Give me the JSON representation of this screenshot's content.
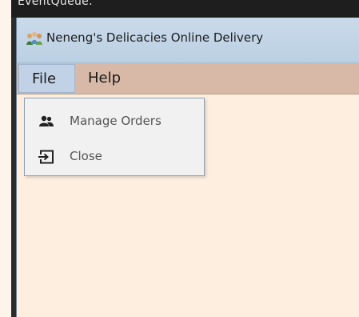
{
  "background": {
    "code_text": "EventQueue."
  },
  "window": {
    "title": "Neneng's Delicacies Online Delivery",
    "app_icon": "people-icon"
  },
  "menubar": {
    "items": [
      {
        "label": "File"
      },
      {
        "label": "Help"
      }
    ]
  },
  "dropdown": {
    "items": [
      {
        "label": "Manage Orders",
        "icon": "users-icon"
      },
      {
        "label": "Close",
        "icon": "exit-icon"
      }
    ]
  }
}
